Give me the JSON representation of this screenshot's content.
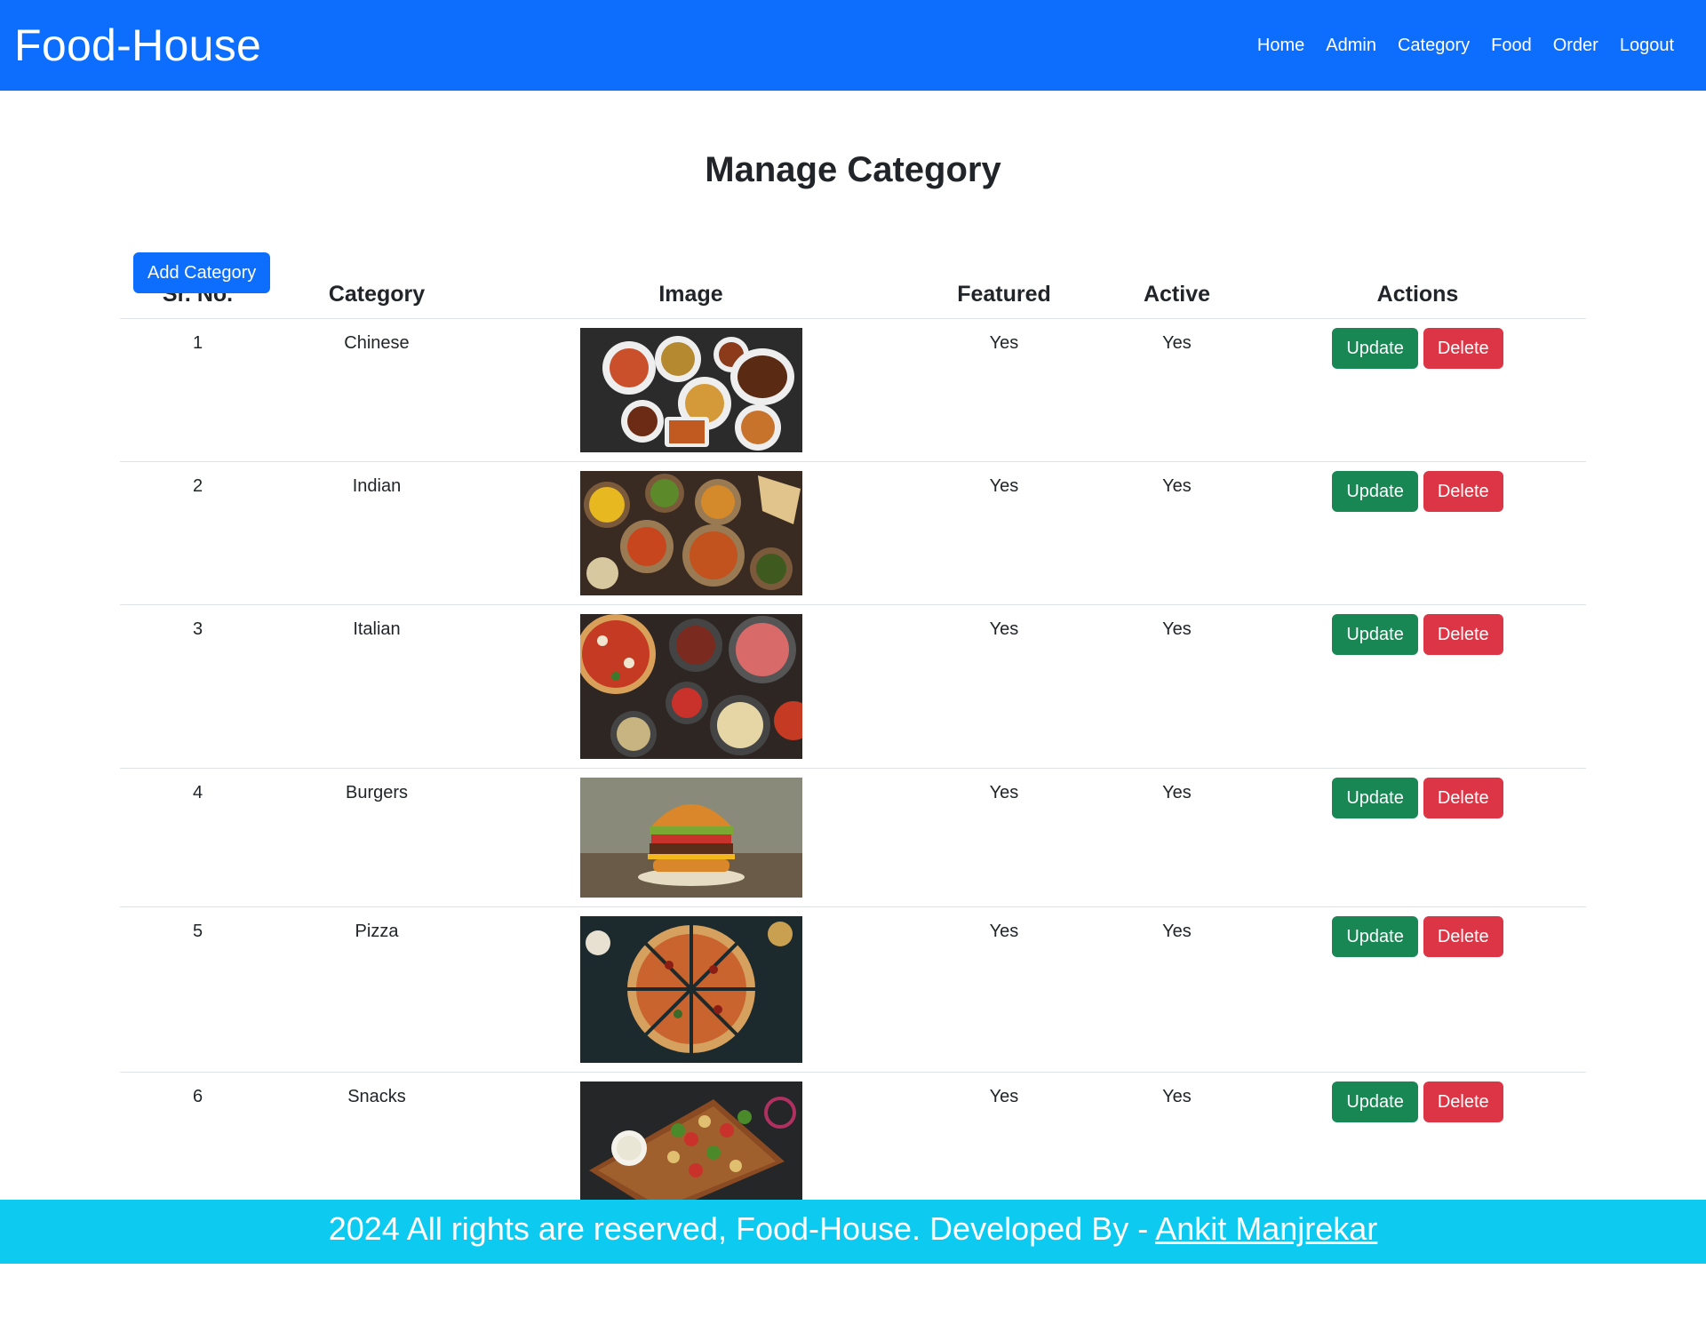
{
  "navbar": {
    "brand": "Food-House",
    "links": [
      "Home",
      "Admin",
      "Category",
      "Food",
      "Order",
      "Logout"
    ]
  },
  "page": {
    "title": "Manage Category",
    "add_button": "Add Category"
  },
  "table": {
    "headers": [
      "Sr. No.",
      "Category",
      "Image",
      "Featured",
      "Active",
      "Actions"
    ],
    "rows": [
      {
        "sr": "1",
        "category": "Chinese",
        "featured": "Yes",
        "active": "Yes",
        "update": "Update",
        "delete": "Delete",
        "image": {
          "kind": "chinese"
        }
      },
      {
        "sr": "2",
        "category": "Indian",
        "featured": "Yes",
        "active": "Yes",
        "update": "Update",
        "delete": "Delete",
        "image": {
          "kind": "indian"
        }
      },
      {
        "sr": "3",
        "category": "Italian",
        "featured": "Yes",
        "active": "Yes",
        "update": "Update",
        "delete": "Delete",
        "image": {
          "kind": "italian"
        }
      },
      {
        "sr": "4",
        "category": "Burgers",
        "featured": "Yes",
        "active": "Yes",
        "update": "Update",
        "delete": "Delete",
        "image": {
          "kind": "burger"
        }
      },
      {
        "sr": "5",
        "category": "Pizza",
        "featured": "Yes",
        "active": "Yes",
        "update": "Update",
        "delete": "Delete",
        "image": {
          "kind": "pizza"
        }
      },
      {
        "sr": "6",
        "category": "Snacks",
        "featured": "Yes",
        "active": "Yes",
        "update": "Update",
        "delete": "Delete",
        "image": {
          "kind": "snacks"
        }
      }
    ]
  },
  "footer": {
    "text": "2024 All rights are reserved, Food-House. Developed By - ",
    "link": "Ankit Manjrekar"
  },
  "colors": {
    "navbar": "#0d6efd",
    "footer": "#0dcaf0",
    "update": "#198754",
    "delete": "#dc3545"
  }
}
